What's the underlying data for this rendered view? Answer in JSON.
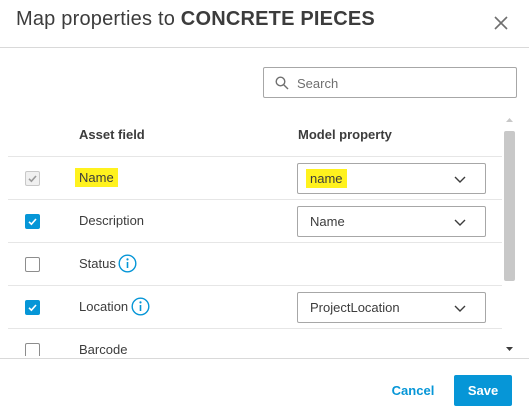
{
  "dialog": {
    "title_prefix": "Map properties to ",
    "title_target": "CONCRETE PIECES"
  },
  "search": {
    "placeholder": "Search",
    "value": ""
  },
  "columns": {
    "asset_field": "Asset field",
    "model_property": "Model property"
  },
  "rows": [
    {
      "field": "Name",
      "checked": true,
      "disabled": true,
      "highlighted": true,
      "has_info": false,
      "model_property": "name"
    },
    {
      "field": "Description",
      "checked": true,
      "disabled": false,
      "highlighted": false,
      "has_info": false,
      "model_property": "Name"
    },
    {
      "field": "Status",
      "checked": false,
      "disabled": false,
      "highlighted": false,
      "has_info": true,
      "model_property": null
    },
    {
      "field": "Location",
      "checked": true,
      "disabled": false,
      "highlighted": false,
      "has_info": true,
      "model_property": "ProjectLocation"
    },
    {
      "field": "Barcode",
      "checked": false,
      "disabled": false,
      "highlighted": false,
      "has_info": false,
      "model_property": null
    }
  ],
  "footer": {
    "cancel_label": "Cancel",
    "save_label": "Save"
  },
  "colors": {
    "accent": "#0696d7",
    "highlight": "#fff21e",
    "text": "#3c3c3c"
  },
  "icons": {
    "close": "close-icon",
    "search": "search-icon",
    "chevron": "chevron-down-icon",
    "info": "info-icon",
    "check": "checkmark-icon"
  }
}
